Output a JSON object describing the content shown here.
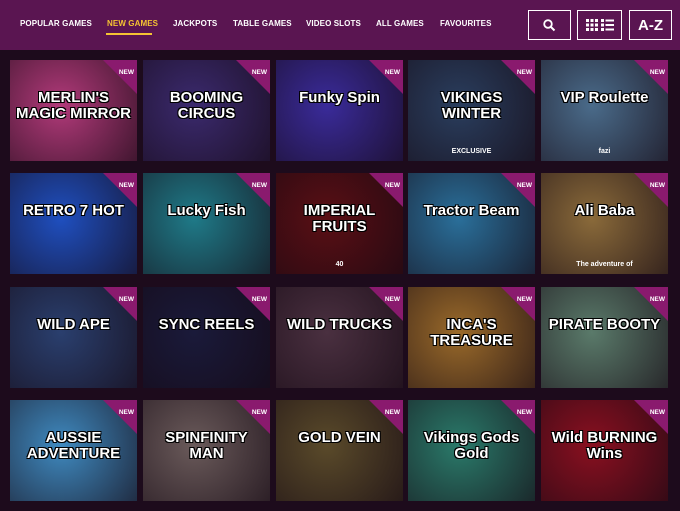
{
  "nav": {
    "items": [
      {
        "label": "POPULAR GAMES",
        "active": false
      },
      {
        "label": "NEW GAMES",
        "active": true
      },
      {
        "label": "JACKPOTS",
        "active": false
      },
      {
        "label": "TABLE GAMES",
        "active": false
      },
      {
        "label": "VIDEO SLOTS",
        "active": false
      },
      {
        "label": "ALL GAMES",
        "active": false
      },
      {
        "label": "FAVOURITES",
        "active": false
      }
    ],
    "search_icon": "search-icon",
    "view_icon": "grid-list-icon",
    "az_label": "A-Z"
  },
  "badge_label": "NEW",
  "colors": {
    "topbar": "#5a1551",
    "accent": "#f5c433",
    "background": "#1d0b1c",
    "badge": "#8a1a6e"
  },
  "games": [
    {
      "title": "MERLIN'S MAGIC MIRROR",
      "sub": "",
      "bg": "#b23a7a"
    },
    {
      "title": "BOOMING CIRCUS",
      "sub": "",
      "bg": "#3b2a6e"
    },
    {
      "title": "Funky Spin",
      "sub": "",
      "bg": "#3a2b9a"
    },
    {
      "title": "VIKINGS WINTER",
      "sub": "EXCLUSIVE",
      "bg": "#2a3e5e"
    },
    {
      "title": "VIP Roulette",
      "sub": "fazi",
      "bg": "#4a6b8a"
    },
    {
      "title": "RETRO 7 HOT",
      "sub": "",
      "bg": "#1f4fbf"
    },
    {
      "title": "Lucky Fish",
      "sub": "",
      "bg": "#1f7a88"
    },
    {
      "title": "IMPERIAL FRUITS",
      "sub": "40",
      "bg": "#5a0f14"
    },
    {
      "title": "Tractor Beam",
      "sub": "",
      "bg": "#2a6f9a"
    },
    {
      "title": "Ali Baba",
      "sub": "The adventure of",
      "bg": "#8a6a3a"
    },
    {
      "title": "WILD APE",
      "sub": "",
      "bg": "#2a3f6e"
    },
    {
      "title": "SYNC REELS",
      "sub": "",
      "bg": "#1a1a3a"
    },
    {
      "title": "WILD TRUCKS",
      "sub": "",
      "bg": "#4a3040"
    },
    {
      "title": "INCA'S TREASURE",
      "sub": "",
      "bg": "#9a6a2a"
    },
    {
      "title": "PIRATE BOOTY",
      "sub": "",
      "bg": "#5a7a6a"
    },
    {
      "title": "AUSSIE ADVENTURE",
      "sub": "",
      "bg": "#3f8ac0"
    },
    {
      "title": "SPINFINITY MAN",
      "sub": "",
      "bg": "#6a5a5a"
    },
    {
      "title": "GOLD VEIN",
      "sub": "",
      "bg": "#5a4a2a"
    },
    {
      "title": "Vikings Gods Gold",
      "sub": "",
      "bg": "#2a7a6a"
    },
    {
      "title": "Wild BURNING Wins",
      "sub": "",
      "bg": "#8a1020"
    }
  ]
}
